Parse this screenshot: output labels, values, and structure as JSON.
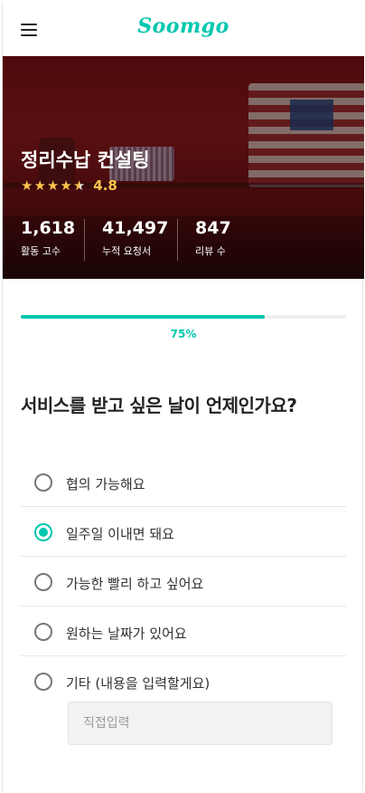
{
  "header": {
    "logo": "Soomgo",
    "menu_icon": "hamburger-menu-icon"
  },
  "hero": {
    "title": "정리수납 컨설팅",
    "rating": {
      "stars_filled": 4.5,
      "stars_total": 5,
      "value": "4.8",
      "star_color": "#ffc44d"
    },
    "stats": [
      {
        "number": "1,618",
        "label": "활동 고수"
      },
      {
        "number": "41,497",
        "label": "누적 요청서"
      },
      {
        "number": "847",
        "label": "리뷰 수"
      }
    ]
  },
  "progress": {
    "percent": 75,
    "label": "75%",
    "color": "#00c7ae"
  },
  "question": {
    "title": "서비스를 받고 싶은 날이 언제인가요?"
  },
  "options": [
    {
      "label": "협의 가능해요",
      "checked": false
    },
    {
      "label": "일주일 이내면 돼요",
      "checked": true
    },
    {
      "label": "가능한 빨리 하고 싶어요",
      "checked": false
    },
    {
      "label": "원하는 날짜가 있어요",
      "checked": false
    },
    {
      "label": "기타 (내용을 입력할게요)",
      "checked": false
    }
  ],
  "custom_input": {
    "value": "",
    "placeholder": "직접입력"
  }
}
